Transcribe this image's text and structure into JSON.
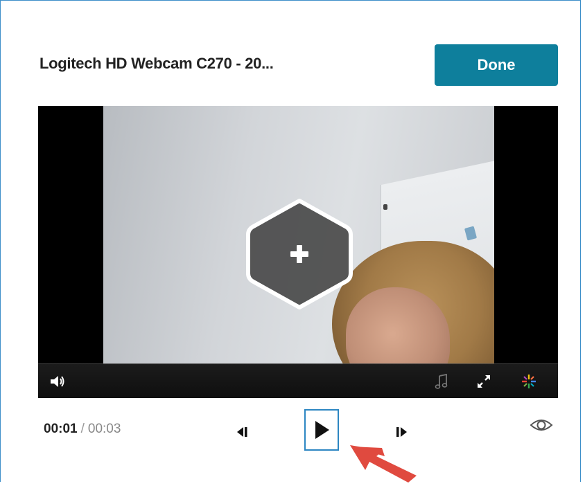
{
  "dialog": {
    "title": "Logitech HD Webcam C270 - 20...",
    "done_label": "Done",
    "accent": "#0e7f9c",
    "border_color": "#3d8fc9"
  },
  "video": {
    "add_button_icon": "hexagon-plus-icon",
    "controls": [
      {
        "name": "volume-icon"
      },
      {
        "name": "music-note-icon"
      },
      {
        "name": "fullscreen-icon"
      },
      {
        "name": "sparkle-icon"
      }
    ]
  },
  "playback": {
    "current_time": "00:01",
    "separator": "/",
    "duration": "00:03",
    "icons": [
      "step-back-icon",
      "play-icon",
      "step-forward-icon",
      "eye-icon"
    ]
  },
  "annotation": {
    "arrow_color": "#e04a3f"
  }
}
